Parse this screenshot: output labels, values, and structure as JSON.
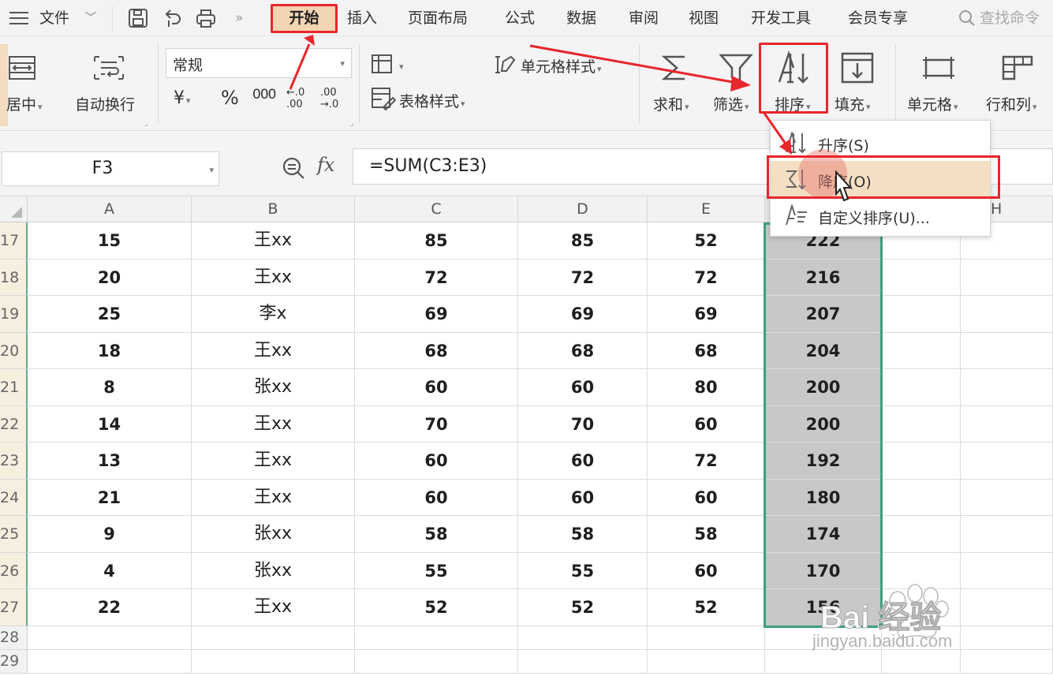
{
  "menu": {
    "file": "文件",
    "tabs": [
      "开始",
      "插入",
      "页面布局",
      "公式",
      "数据",
      "审阅",
      "视图",
      "开发工具",
      "会员专享"
    ],
    "search": "查找命令"
  },
  "ribbon": {
    "merge_center": "居中",
    "wrap_text": "自动换行",
    "number_format": "常规",
    "currency": "¥",
    "percent": "%",
    "thousands": "000",
    "inc_decimal": "←.0 .00",
    "dec_decimal": ".00 →.0",
    "cond_format": "",
    "cell_style": "单元格样式",
    "table_style": "表格样式",
    "sum": "求和",
    "filter": "筛选",
    "sort": "排序",
    "fill": "填充",
    "cell": "单元格",
    "row_col": "行和列"
  },
  "formula_bar": {
    "name_box": "F3",
    "fx": "fx",
    "formula": "=SUM(C3:E3)"
  },
  "columns": [
    "A",
    "B",
    "C",
    "D",
    "E",
    "",
    "",
    "H"
  ],
  "rows": [
    {
      "n": "17",
      "cells": [
        "15",
        "王xx",
        "85",
        "85",
        "52",
        "222"
      ]
    },
    {
      "n": "18",
      "cells": [
        "20",
        "王xx",
        "72",
        "72",
        "72",
        "216"
      ]
    },
    {
      "n": "19",
      "cells": [
        "25",
        "李x",
        "69",
        "69",
        "69",
        "207"
      ]
    },
    {
      "n": "20",
      "cells": [
        "18",
        "王xx",
        "68",
        "68",
        "68",
        "204"
      ]
    },
    {
      "n": "21",
      "cells": [
        "8",
        "张xx",
        "60",
        "60",
        "80",
        "200"
      ]
    },
    {
      "n": "22",
      "cells": [
        "14",
        "王xx",
        "70",
        "70",
        "60",
        "200"
      ]
    },
    {
      "n": "23",
      "cells": [
        "13",
        "王xx",
        "60",
        "60",
        "72",
        "192"
      ]
    },
    {
      "n": "24",
      "cells": [
        "21",
        "王xx",
        "60",
        "60",
        "60",
        "180"
      ]
    },
    {
      "n": "25",
      "cells": [
        "9",
        "张xx",
        "58",
        "58",
        "58",
        "174"
      ]
    },
    {
      "n": "26",
      "cells": [
        "4",
        "张xx",
        "55",
        "55",
        "60",
        "170"
      ]
    },
    {
      "n": "27",
      "cells": [
        "22",
        "王xx",
        "52",
        "52",
        "52",
        "156"
      ]
    }
  ],
  "empty_rows": [
    "28",
    "29"
  ],
  "sort_menu": {
    "ascending": "升序(S)",
    "descending": "降序(O)",
    "custom": "自定义排序(U)..."
  },
  "watermark": {
    "brand": "Bai  经验",
    "url": "jingyan.baidu.com"
  },
  "colors": {
    "highlight_red": "#e8262b",
    "selection_green": "#3f9f79",
    "active_tab_bg": "#f3d4b3",
    "selected_cell_bg": "#c8c8c8"
  }
}
